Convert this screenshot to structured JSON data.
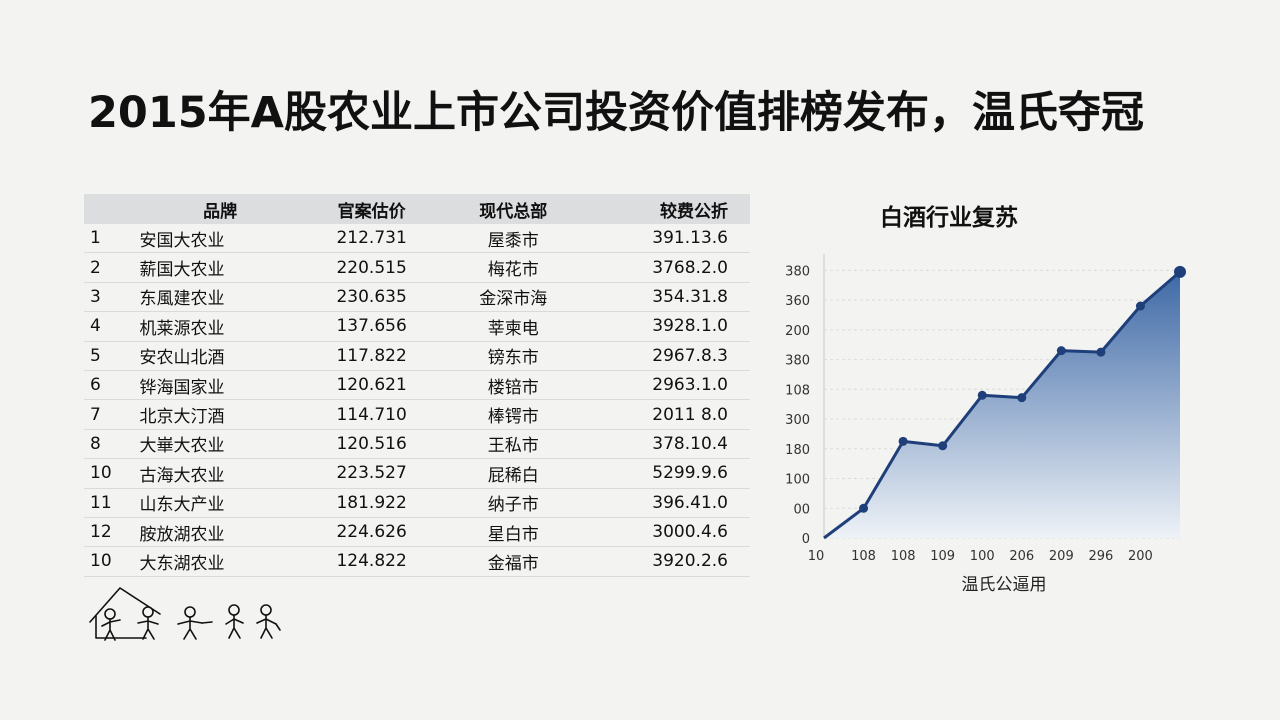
{
  "title": "2015年A股农业上市公司投资价值排榜发布，温氏夺冠",
  "table": {
    "headers": [
      "",
      "品牌",
      "官案估价",
      "现代总部",
      "较费公折"
    ],
    "rows": [
      [
        "1",
        "安国大农业",
        "212.731",
        "屋黍市",
        "391.13.6"
      ],
      [
        "2",
        "薪国大农业",
        "220.515",
        "梅花市",
        "3768.2.0"
      ],
      [
        "3",
        "东風建农业",
        "230.635",
        "金深市海",
        "354.31.8"
      ],
      [
        "4",
        "机莱源农业",
        "137.656",
        "莘柬电",
        "3928.1.0"
      ],
      [
        "5",
        "安农山北酒",
        "117.822",
        "镑东市",
        "2967.8.3"
      ],
      [
        "6",
        "铧海国家业",
        "120.621",
        "楼锫市",
        "2963.1.0"
      ],
      [
        "7",
        "北京大汀酒",
        "114.710",
        "棒锷市",
        "2011 8.0"
      ],
      [
        "8",
        "大崋大农业",
        "120.516",
        "王私市",
        "378.10.4"
      ],
      [
        "10",
        "古海大农业",
        "223.527",
        "屁稀白",
        "5299.9.6"
      ],
      [
        "11",
        "山东大产业",
        "181.922",
        "纳子市",
        "396.41.0"
      ],
      [
        "12",
        "胺放湖农业",
        "224.626",
        "星白市",
        "3000.4.6"
      ],
      [
        "10",
        "大东湖农业",
        "124.822",
        "金福市",
        "3920.2.6"
      ]
    ]
  },
  "chart_data": {
    "type": "area",
    "title": "白酒行业复苏",
    "xlabel": "温氏公逼用",
    "ylabel": "",
    "y_tick_labels": [
      "0",
      "00",
      "100",
      "180",
      "300",
      "108",
      "380",
      "200",
      "360",
      "380"
    ],
    "x_tick_labels": [
      "10",
      "108",
      "108",
      "109",
      "100",
      "206",
      "209",
      "296",
      "200"
    ],
    "series": [
      {
        "values": [
          0,
          1,
          3.25,
          3.1,
          4.8,
          4.72,
          6.3,
          6.25,
          7.8,
          8.95
        ]
      }
    ],
    "ylim": [
      0,
      9.55
    ],
    "xlim": [
      0,
      9
    ],
    "colors": {
      "line": "#1f3f7a",
      "fill_top": "#3e69a6",
      "fill_bottom": "#eef2f7"
    }
  },
  "decoration": {
    "people_icon": "people-drawing-icon"
  }
}
